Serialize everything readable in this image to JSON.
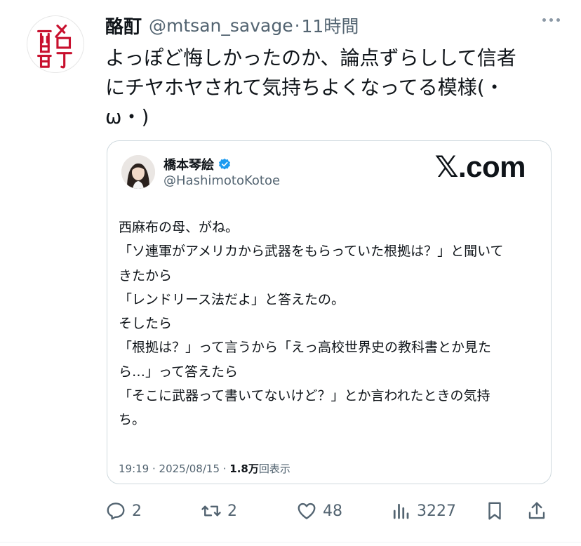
{
  "tweet": {
    "author_name": "酪酊",
    "handle": "@mtsan_savage",
    "separator": "·",
    "time": "11時間",
    "text_lines": [
      "よっぽど悔しかったのか、論点ずらしして信者",
      "にチヤホヤされて気持ちよくなってる模様(・",
      "ω・)"
    ]
  },
  "quote": {
    "author_name": "橋本琴絵",
    "handle": "@HashimotoKotoe",
    "source_logo": "𝕏.com",
    "body_lines": [
      "西麻布の母、がね。",
      "「ソ連軍がアメリカから武器をもらっていた根拠は？」と聞いて",
      "きたから",
      "「レンドリース法だよ」と答えたの。",
      "そしたら",
      "「根拠は？」って言うから「えっ高校世界史の教科書とか見た",
      "ら…」って答えたら",
      "「そこに武器って書いてないけど？」とか言われたときの気持",
      "ち。"
    ],
    "meta_prefix": "19:19 · 2025/08/15 · ",
    "views_count": "1.8万",
    "views_label": "回表示"
  },
  "actions": {
    "replies": "2",
    "retweets": "2",
    "likes": "48",
    "views": "3227"
  },
  "icons": {
    "reply": "reply-icon",
    "retweet": "retweet-icon",
    "like": "heart-icon",
    "views": "analytics-icon",
    "bookmark": "bookmark-icon",
    "share": "share-icon",
    "more": "more-icon",
    "verified": "verified-badge-icon"
  },
  "colors": {
    "text": "#0f1419",
    "secondary": "#536471",
    "verified": "#1d9bf0",
    "avatar_red": "#c8102e"
  }
}
